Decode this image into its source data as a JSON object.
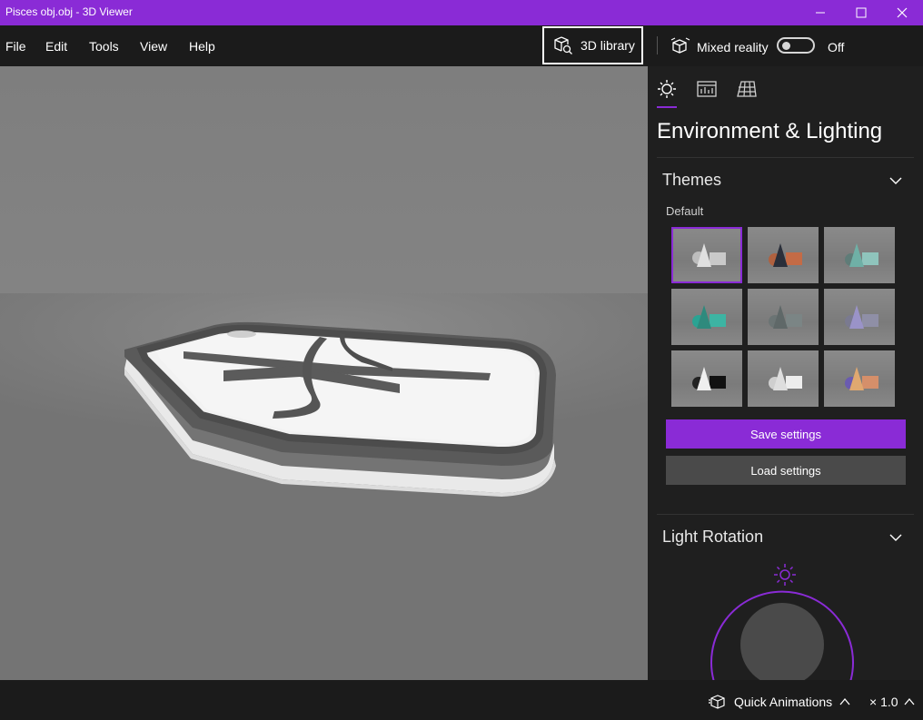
{
  "window": {
    "title": "Pisces obj.obj - 3D Viewer"
  },
  "menu": {
    "items": [
      "File",
      "Edit",
      "Tools",
      "View",
      "Help"
    ]
  },
  "toolbar": {
    "library_label": "3D library",
    "mixed_reality_label": "Mixed reality",
    "mixed_reality_state": "Off"
  },
  "panel": {
    "title": "Environment & Lighting",
    "tabs": [
      "lighting-tab",
      "stats-tab",
      "grid-tab"
    ],
    "themes": {
      "title": "Themes",
      "selected_label": "Default",
      "save_label": "Save settings",
      "load_label": "Load settings"
    },
    "light_rotation": {
      "title": "Light Rotation"
    }
  },
  "status": {
    "quick_animations_label": "Quick Animations",
    "zoom_label": "× 1.0"
  },
  "colors": {
    "accent": "#8a2bd6",
    "background": "#1f1f1f"
  }
}
